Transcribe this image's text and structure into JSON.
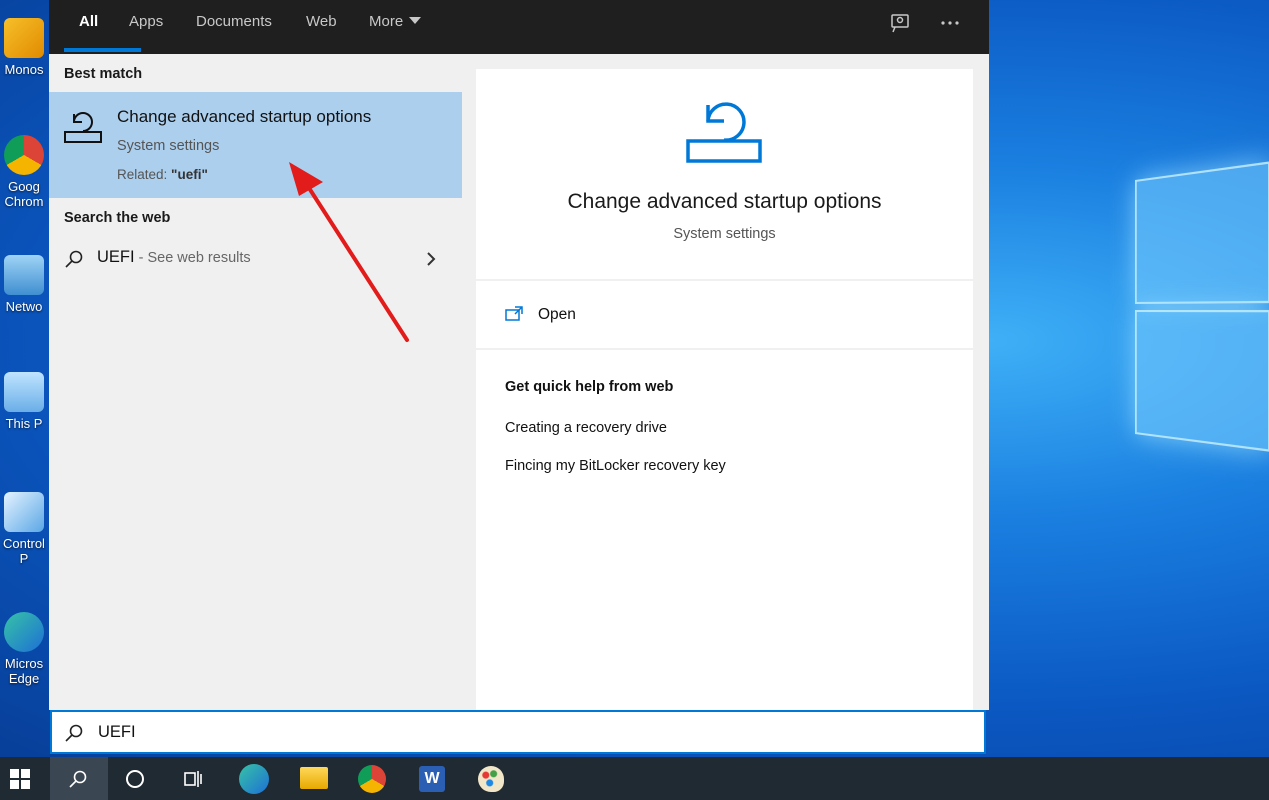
{
  "tabs": [
    {
      "label": "All"
    },
    {
      "label": "Apps"
    },
    {
      "label": "Documents"
    },
    {
      "label": "Web"
    },
    {
      "label": "More"
    }
  ],
  "desktop_icons": [
    {
      "label": "Monos"
    },
    {
      "label": "Goog Chrom"
    },
    {
      "label": "Netwo"
    },
    {
      "label": "This P"
    },
    {
      "label": "Control P"
    },
    {
      "label": "Micros Edge"
    }
  ],
  "results": {
    "best_match_label": "Best match",
    "best_match": {
      "title": "Change advanced startup options",
      "subtitle": "System settings",
      "related_prefix": "Related: ",
      "related_term": "\"uefi\""
    },
    "search_web_label": "Search the web",
    "web_result": {
      "query": "UEFI",
      "hint": " - See web results"
    }
  },
  "preview": {
    "title": "Change advanced startup options",
    "subtitle": "System settings",
    "open_label": "Open",
    "help_heading": "Get quick help from web",
    "help_links": [
      "Creating a recovery drive",
      "Fincing my BitLocker recovery key"
    ]
  },
  "search": {
    "value": "UEFI"
  },
  "colors": {
    "accent": "#0078d7",
    "selected": "#accfee",
    "topbar": "#1f1f1f"
  }
}
